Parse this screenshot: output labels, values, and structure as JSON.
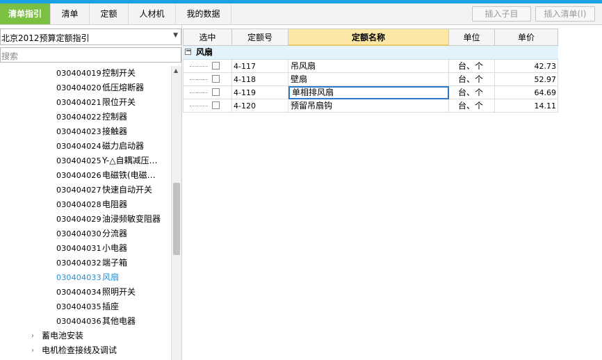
{
  "tabs": [
    {
      "label": "清单指引",
      "active": true
    },
    {
      "label": "清单",
      "active": false
    },
    {
      "label": "定额",
      "active": false
    },
    {
      "label": "人材机",
      "active": false
    },
    {
      "label": "我的数据",
      "active": false
    }
  ],
  "toolbar": {
    "insert_child_label": "插入子目",
    "insert_list_label": "插入清单(I)"
  },
  "sidebar": {
    "selector_value": "北京2012预算定额指引",
    "search_placeholder": "搜索",
    "items": [
      {
        "code": "030404019",
        "name": "控制开关"
      },
      {
        "code": "030404020",
        "name": "低压熔断器"
      },
      {
        "code": "030404021",
        "name": "限位开关"
      },
      {
        "code": "030404022",
        "name": "控制器"
      },
      {
        "code": "030404023",
        "name": "接触器"
      },
      {
        "code": "030404024",
        "name": "磁力启动器"
      },
      {
        "code": "030404025",
        "name": "Y-△自耦减压…"
      },
      {
        "code": "030404026",
        "name": "电磁铁(电磁…"
      },
      {
        "code": "030404027",
        "name": "快速自动开关"
      },
      {
        "code": "030404028",
        "name": "电阻器"
      },
      {
        "code": "030404029",
        "name": "油浸频敏变阻器"
      },
      {
        "code": "030404030",
        "name": "分流器"
      },
      {
        "code": "030404031",
        "name": "小电器"
      },
      {
        "code": "030404032",
        "name": "端子箱"
      },
      {
        "code": "030404033",
        "name": "风扇",
        "selected": true
      },
      {
        "code": "030404034",
        "name": "照明开关"
      },
      {
        "code": "030404035",
        "name": "插座"
      },
      {
        "code": "030404036",
        "name": "其他电器"
      }
    ],
    "folders": [
      {
        "label": "蓄电池安装"
      },
      {
        "label": "电机检查接线及调试"
      }
    ]
  },
  "grid": {
    "headers": {
      "select": "选中",
      "code": "定额号",
      "name": "定额名称",
      "unit": "单位",
      "price": "单价"
    },
    "group_label": "风扇",
    "rows": [
      {
        "code": "4-117",
        "name": "吊风扇",
        "unit": "台、个",
        "price": "42.73"
      },
      {
        "code": "4-118",
        "name": "壁扇",
        "unit": "台、个",
        "price": "52.97"
      },
      {
        "code": "4-119",
        "name": "单相排风扇",
        "unit": "台、个",
        "price": "64.69"
      },
      {
        "code": "4-120",
        "name": "预留吊扇钩",
        "unit": "台、个",
        "price": "14.11"
      }
    ]
  },
  "colors": {
    "accent_top": "#1aa3e0",
    "active_tab": "#7bc043",
    "selected_item": "#1e8fd6",
    "header_highlight": "#fde8a6",
    "group_row": "#e4f3fb"
  }
}
